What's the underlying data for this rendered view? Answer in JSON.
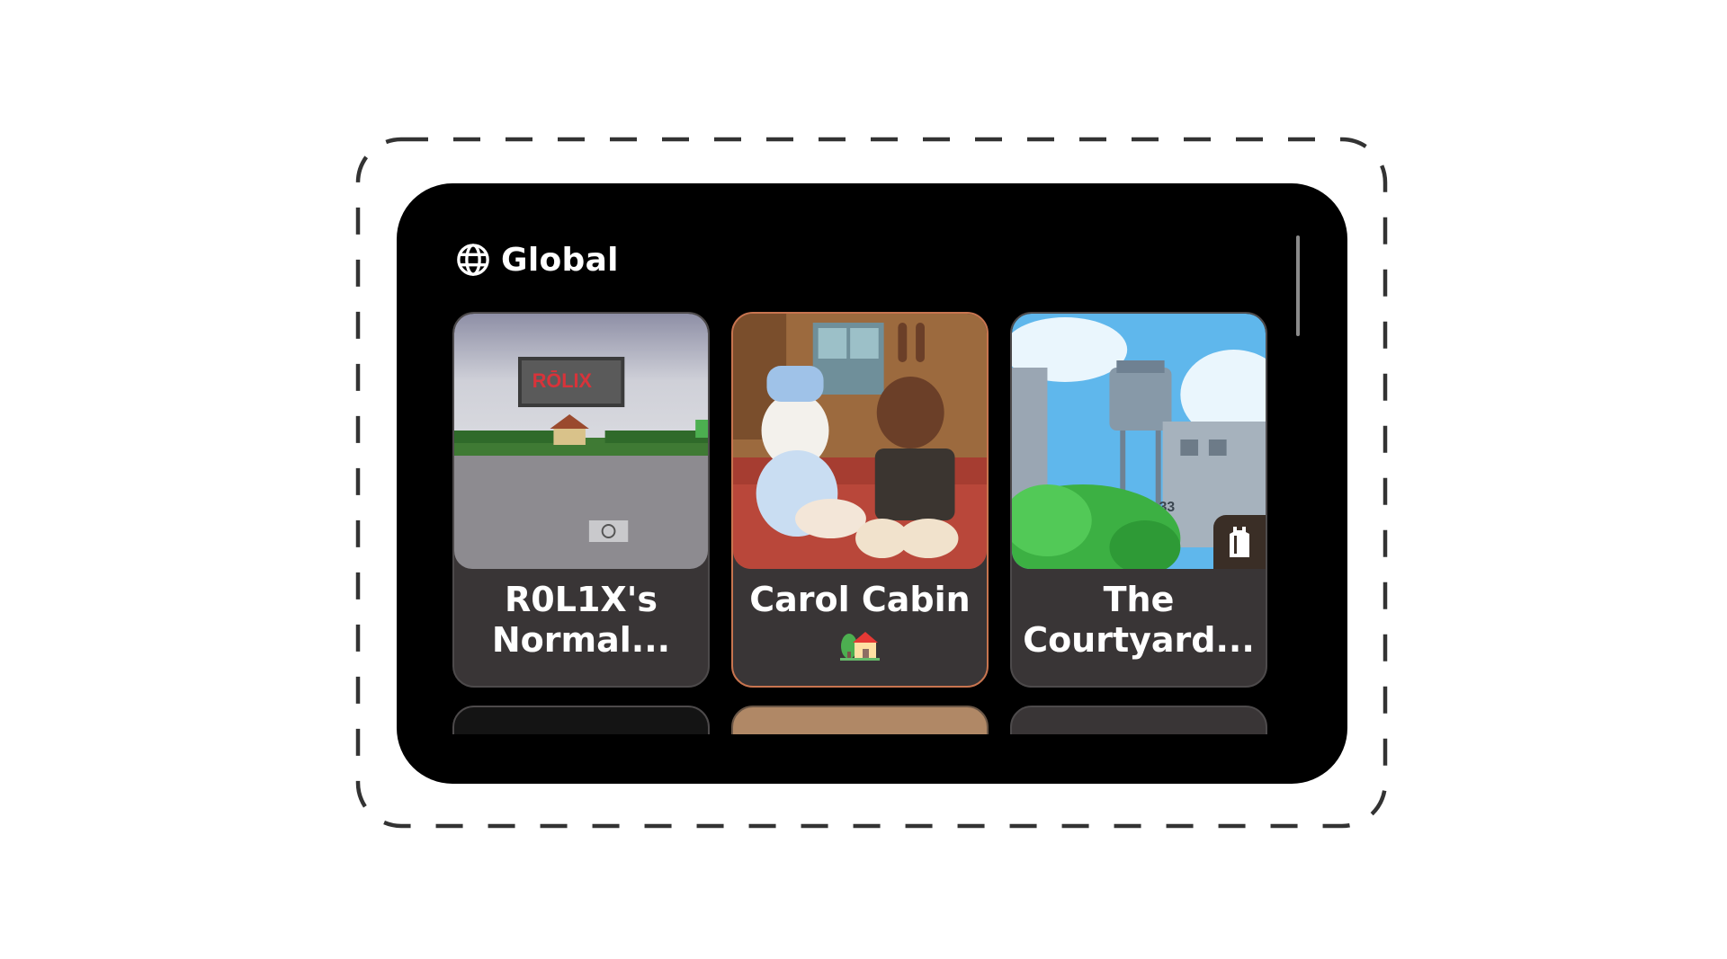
{
  "section": {
    "title": "Global",
    "icon": "globe-icon"
  },
  "cards": [
    {
      "title": "R0L1X's\nNormal...",
      "thumbnail": "roblox-hq-sign-scene"
    },
    {
      "title": "Carol Cabin",
      "emoji": "house-with-garden-emoji",
      "thumbnail": "two-avatars-on-couch"
    },
    {
      "title": "The\nCourtyard...",
      "thumbnail": "water-tower-scene",
      "badge": "shirt-icon"
    }
  ],
  "colors": {
    "panel_bg": "#000000",
    "card_bg": "#393536",
    "highlight_border": "#c8744f",
    "text": "#ffffff"
  }
}
